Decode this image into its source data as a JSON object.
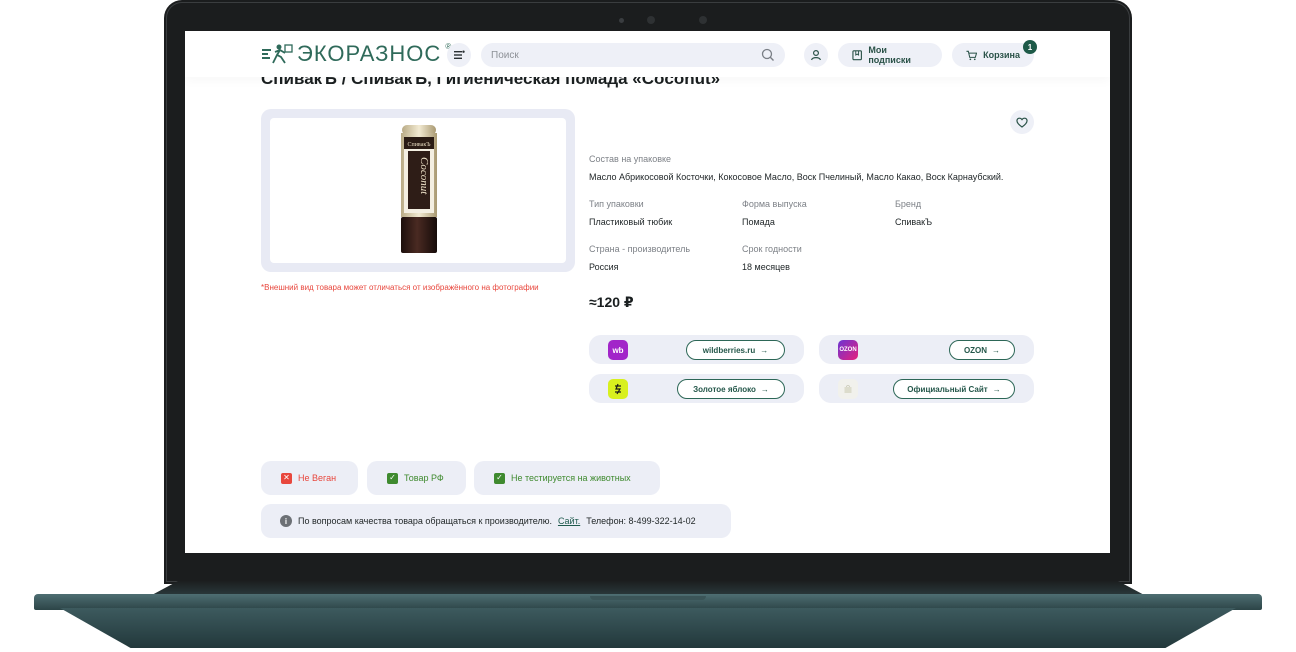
{
  "header": {
    "logo_text": "ЭКОРАЗНОС",
    "logo_reg": "®",
    "search_placeholder": "Поиск",
    "subscriptions_label": "Мои подписки",
    "cart_label": "Корзина",
    "cart_count": "1"
  },
  "product": {
    "title": "СпивакЪ / СпивакЪ, Гигиеническая помада «Coconut»",
    "image_label": "Coconut",
    "image_brand": "СпивакЪ",
    "disclaimer": "*Внешний вид товара может отличаться от изображённого на фотографии",
    "composition_label": "Состав на упаковке",
    "composition_value": "Масло Абрикосовой Косточки, Кокосовое Масло, Воск Пчелиный, Масло Какао, Воск Карнаубский.",
    "attributes": [
      {
        "label": "Тип упаковки",
        "value": "Пластиковый тюбик"
      },
      {
        "label": "Форма выпуска",
        "value": "Помада"
      },
      {
        "label": "Бренд",
        "value": "СпивакЪ"
      },
      {
        "label": "Страна - производитель",
        "value": "Россия"
      },
      {
        "label": "Срок годности",
        "value": "18 месяцев"
      }
    ],
    "price": "≈120 ₽"
  },
  "shops": [
    {
      "logo": "wb",
      "link": "wildberries.ru",
      "color": "#a225c9"
    },
    {
      "logo": "OZON",
      "link": "OZON",
      "color": "#6b35d4"
    },
    {
      "logo": "",
      "link": "Золотое яблоко",
      "color": "#d8f01e"
    },
    {
      "logo": "",
      "link": "Официальный Сайт",
      "color": "#f1f1ec"
    }
  ],
  "arrow": "→",
  "tags": [
    {
      "label": "Не Веган",
      "mark": "✕",
      "status": "bad"
    },
    {
      "label": "Товар РФ",
      "mark": "✓",
      "status": "good"
    },
    {
      "label": "Не тестируется на животных",
      "mark": "✓",
      "status": "good"
    }
  ],
  "info": {
    "icon": "i",
    "text_before": "По вопросам качества товара обращаться к производителю.",
    "link": "Сайт.",
    "text_after": "Телефон: 8-499-322-14-02"
  },
  "colors": {
    "accent": "#2f6a5a",
    "danger": "#e8473d",
    "success": "#3f8a2f"
  }
}
